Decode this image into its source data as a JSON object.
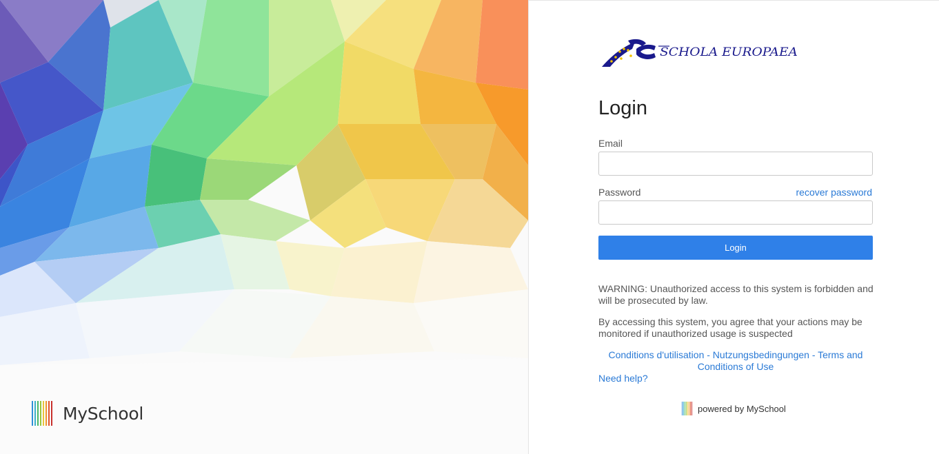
{
  "left": {
    "brand_name": "MySchool",
    "stripe_colors": [
      "#2f8fd8",
      "#3cb0c8",
      "#48b868",
      "#9ac63c",
      "#e8c53a",
      "#f0962c",
      "#e0522c",
      "#c8302c"
    ]
  },
  "school_logo": {
    "monogram": "SE",
    "wordmark": "SCHOLA EUROPAEA"
  },
  "login": {
    "title": "Login",
    "email_label": "Email",
    "email_value": "",
    "password_label": "Password",
    "password_value": "",
    "recover_label": "recover password",
    "button_label": "Login"
  },
  "notices": {
    "warning": "WARNING: Unauthorized access to this system is forbidden and will be prosecuted by law.",
    "consent": "By accessing this system, you agree that your actions may be monitored if unauthorized usage is suspected"
  },
  "links": {
    "terms": "Conditions d'utilisation - Nutzungsbedingungen - Terms and Conditions of Use",
    "help": "Need help?"
  },
  "footer": {
    "powered_by": "powered by MySchool"
  },
  "colors": {
    "accent": "#2f80e8",
    "link": "#2a7ad6",
    "logo_blue": "#1a1a8c",
    "logo_gold": "#f2c200"
  }
}
